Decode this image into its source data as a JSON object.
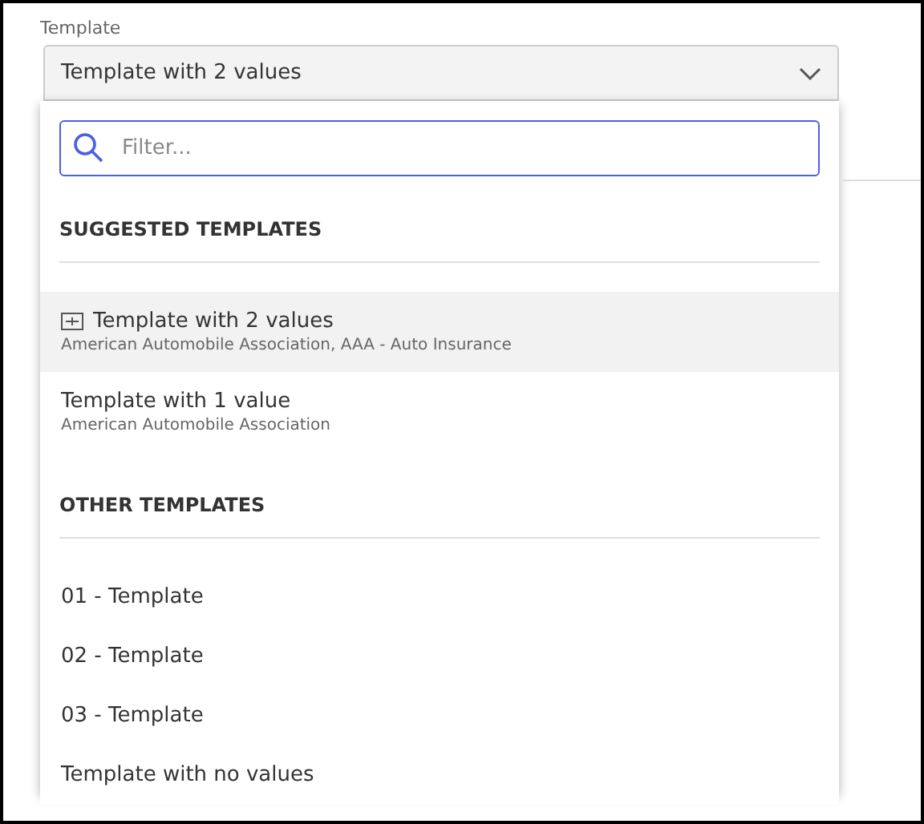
{
  "field": {
    "label": "Template",
    "value": "Template with 2 values",
    "expanded": true
  },
  "filter": {
    "placeholder": "Filter..."
  },
  "sections": [
    {
      "heading": "SUGGESTED TEMPLATES",
      "items": [
        {
          "title": "Template with 2 values",
          "subtitle": "American Automobile Association, AAA - Auto Insurance",
          "selected": true
        },
        {
          "title": "Template with 1 value",
          "subtitle": "American Automobile Association",
          "selected": false
        }
      ]
    },
    {
      "heading": "OTHER TEMPLATES",
      "items": [
        {
          "title": "01 - Template",
          "selected": false
        },
        {
          "title": "02 - Template",
          "selected": false
        },
        {
          "title": "03 - Template",
          "selected": false
        },
        {
          "title": "Template with no values",
          "selected": false
        }
      ]
    }
  ]
}
